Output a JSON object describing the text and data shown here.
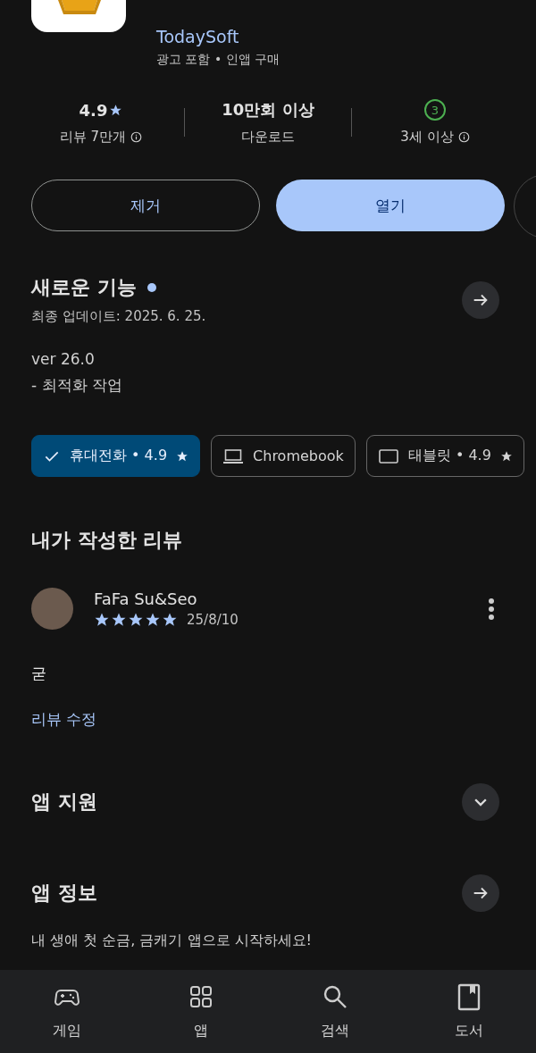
{
  "app": {
    "developer": "TodaySoft",
    "notes": "광고 포함 • 인앱 구매"
  },
  "stats": [
    {
      "kind": "rating",
      "value": "4.9",
      "label": "리뷰 7만개"
    },
    {
      "kind": "plain",
      "value": "10만회 이상",
      "label": "다운로드"
    },
    {
      "kind": "age",
      "value": "3",
      "label": "3세 이상"
    }
  ],
  "buttons": [
    {
      "label": "제거",
      "kind": "outlined"
    },
    {
      "label": "열기",
      "kind": "filled"
    }
  ],
  "whats_new": {
    "title": "새로운 기능",
    "date": "최종 업데이트: 2025. 6. 25.",
    "lines": [
      "ver 26.0",
      "- 최적화 작업"
    ]
  },
  "device_chips": [
    {
      "label": "휴대전화 • 4.9",
      "star": true,
      "selected": true
    },
    {
      "kind": "laptop",
      "label": "Chromebook",
      "star": false,
      "selected": false
    },
    {
      "kind": "tablet",
      "label": "태블릿 • 4.9",
      "star": true,
      "selected": false
    }
  ],
  "my_review": {
    "title": "내가 작성한 리뷰",
    "author": "FaFa Su&Seo",
    "stars": 5,
    "date": "25/8/10",
    "text": "굳",
    "edit_link": "리뷰 수정"
  },
  "sections": [
    {
      "title": "앱 지원",
      "kind": "expand"
    },
    {
      "title": "앱 정보",
      "kind": "next",
      "body": "내 생애 첫 순금, 금캐기 앱으로 시작하세요!"
    }
  ],
  "bottom_nav": [
    {
      "kind": "games",
      "label": "게임"
    },
    {
      "kind": "apps",
      "label": "앱"
    },
    {
      "kind": "search",
      "label": "검색"
    },
    {
      "kind": "books",
      "label": "도서"
    }
  ]
}
